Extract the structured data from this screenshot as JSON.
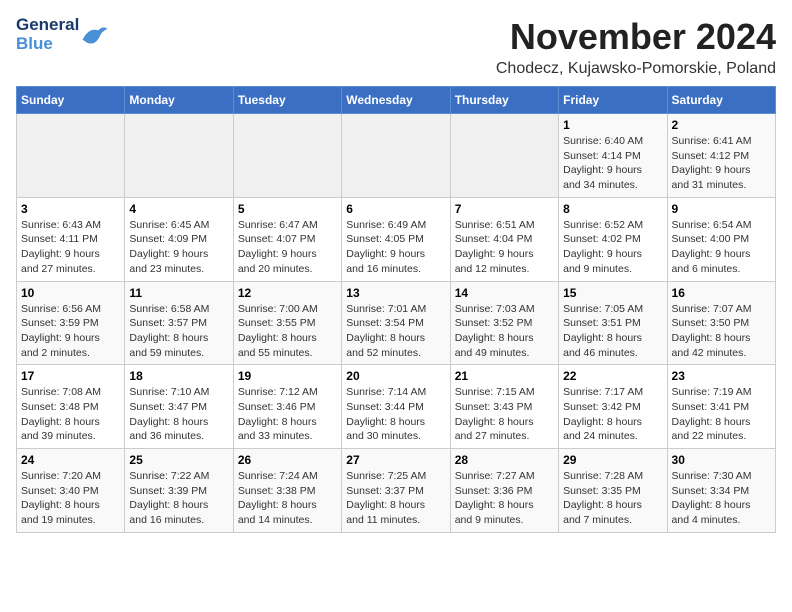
{
  "header": {
    "logo_general": "General",
    "logo_blue": "Blue",
    "month_title": "November 2024",
    "location": "Chodecz, Kujawsko-Pomorskie, Poland"
  },
  "weekdays": [
    "Sunday",
    "Monday",
    "Tuesday",
    "Wednesday",
    "Thursday",
    "Friday",
    "Saturday"
  ],
  "weeks": [
    [
      {
        "day": "",
        "info": ""
      },
      {
        "day": "",
        "info": ""
      },
      {
        "day": "",
        "info": ""
      },
      {
        "day": "",
        "info": ""
      },
      {
        "day": "",
        "info": ""
      },
      {
        "day": "1",
        "info": "Sunrise: 6:40 AM\nSunset: 4:14 PM\nDaylight: 9 hours\nand 34 minutes."
      },
      {
        "day": "2",
        "info": "Sunrise: 6:41 AM\nSunset: 4:12 PM\nDaylight: 9 hours\nand 31 minutes."
      }
    ],
    [
      {
        "day": "3",
        "info": "Sunrise: 6:43 AM\nSunset: 4:11 PM\nDaylight: 9 hours\nand 27 minutes."
      },
      {
        "day": "4",
        "info": "Sunrise: 6:45 AM\nSunset: 4:09 PM\nDaylight: 9 hours\nand 23 minutes."
      },
      {
        "day": "5",
        "info": "Sunrise: 6:47 AM\nSunset: 4:07 PM\nDaylight: 9 hours\nand 20 minutes."
      },
      {
        "day": "6",
        "info": "Sunrise: 6:49 AM\nSunset: 4:05 PM\nDaylight: 9 hours\nand 16 minutes."
      },
      {
        "day": "7",
        "info": "Sunrise: 6:51 AM\nSunset: 4:04 PM\nDaylight: 9 hours\nand 12 minutes."
      },
      {
        "day": "8",
        "info": "Sunrise: 6:52 AM\nSunset: 4:02 PM\nDaylight: 9 hours\nand 9 minutes."
      },
      {
        "day": "9",
        "info": "Sunrise: 6:54 AM\nSunset: 4:00 PM\nDaylight: 9 hours\nand 6 minutes."
      }
    ],
    [
      {
        "day": "10",
        "info": "Sunrise: 6:56 AM\nSunset: 3:59 PM\nDaylight: 9 hours\nand 2 minutes."
      },
      {
        "day": "11",
        "info": "Sunrise: 6:58 AM\nSunset: 3:57 PM\nDaylight: 8 hours\nand 59 minutes."
      },
      {
        "day": "12",
        "info": "Sunrise: 7:00 AM\nSunset: 3:55 PM\nDaylight: 8 hours\nand 55 minutes."
      },
      {
        "day": "13",
        "info": "Sunrise: 7:01 AM\nSunset: 3:54 PM\nDaylight: 8 hours\nand 52 minutes."
      },
      {
        "day": "14",
        "info": "Sunrise: 7:03 AM\nSunset: 3:52 PM\nDaylight: 8 hours\nand 49 minutes."
      },
      {
        "day": "15",
        "info": "Sunrise: 7:05 AM\nSunset: 3:51 PM\nDaylight: 8 hours\nand 46 minutes."
      },
      {
        "day": "16",
        "info": "Sunrise: 7:07 AM\nSunset: 3:50 PM\nDaylight: 8 hours\nand 42 minutes."
      }
    ],
    [
      {
        "day": "17",
        "info": "Sunrise: 7:08 AM\nSunset: 3:48 PM\nDaylight: 8 hours\nand 39 minutes."
      },
      {
        "day": "18",
        "info": "Sunrise: 7:10 AM\nSunset: 3:47 PM\nDaylight: 8 hours\nand 36 minutes."
      },
      {
        "day": "19",
        "info": "Sunrise: 7:12 AM\nSunset: 3:46 PM\nDaylight: 8 hours\nand 33 minutes."
      },
      {
        "day": "20",
        "info": "Sunrise: 7:14 AM\nSunset: 3:44 PM\nDaylight: 8 hours\nand 30 minutes."
      },
      {
        "day": "21",
        "info": "Sunrise: 7:15 AM\nSunset: 3:43 PM\nDaylight: 8 hours\nand 27 minutes."
      },
      {
        "day": "22",
        "info": "Sunrise: 7:17 AM\nSunset: 3:42 PM\nDaylight: 8 hours\nand 24 minutes."
      },
      {
        "day": "23",
        "info": "Sunrise: 7:19 AM\nSunset: 3:41 PM\nDaylight: 8 hours\nand 22 minutes."
      }
    ],
    [
      {
        "day": "24",
        "info": "Sunrise: 7:20 AM\nSunset: 3:40 PM\nDaylight: 8 hours\nand 19 minutes."
      },
      {
        "day": "25",
        "info": "Sunrise: 7:22 AM\nSunset: 3:39 PM\nDaylight: 8 hours\nand 16 minutes."
      },
      {
        "day": "26",
        "info": "Sunrise: 7:24 AM\nSunset: 3:38 PM\nDaylight: 8 hours\nand 14 minutes."
      },
      {
        "day": "27",
        "info": "Sunrise: 7:25 AM\nSunset: 3:37 PM\nDaylight: 8 hours\nand 11 minutes."
      },
      {
        "day": "28",
        "info": "Sunrise: 7:27 AM\nSunset: 3:36 PM\nDaylight: 8 hours\nand 9 minutes."
      },
      {
        "day": "29",
        "info": "Sunrise: 7:28 AM\nSunset: 3:35 PM\nDaylight: 8 hours\nand 7 minutes."
      },
      {
        "day": "30",
        "info": "Sunrise: 7:30 AM\nSunset: 3:34 PM\nDaylight: 8 hours\nand 4 minutes."
      }
    ]
  ]
}
